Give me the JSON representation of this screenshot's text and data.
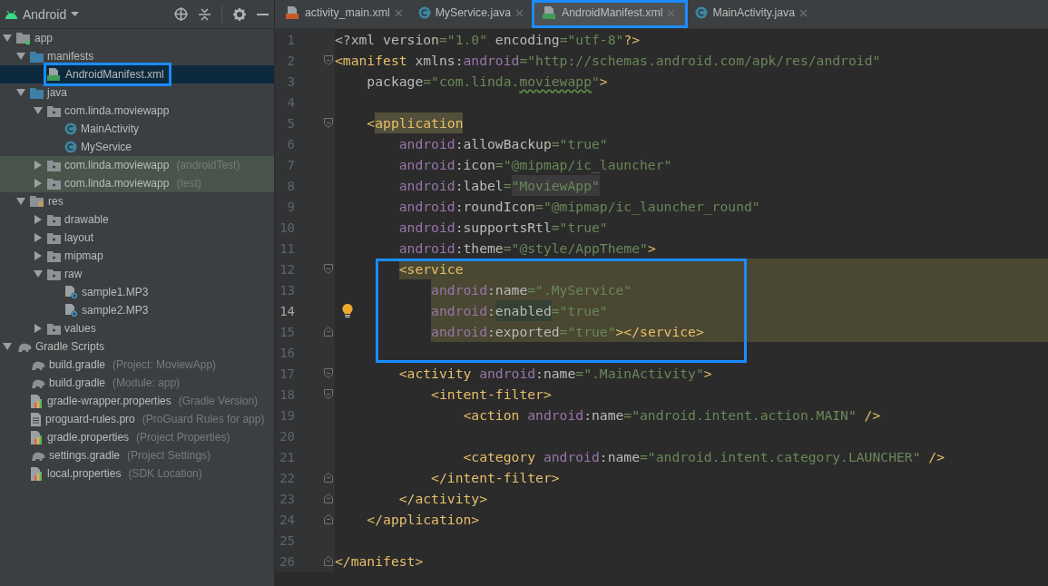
{
  "project_panel": {
    "view_title": "Android",
    "tree": [
      {
        "label": "app",
        "kind": "module",
        "expanded": true,
        "selected": false,
        "children": [
          {
            "label": "manifests",
            "kind": "folder",
            "expanded": true,
            "selected": false,
            "children": [
              {
                "label": "AndroidManifest.xml",
                "kind": "manifest",
                "selected": true,
                "annotated": true
              }
            ]
          },
          {
            "label": "java",
            "kind": "folder",
            "expanded": true,
            "selected": false,
            "children": [
              {
                "label": "com.linda.moviewapp",
                "kind": "package",
                "expanded": true,
                "selected": false,
                "children": [
                  {
                    "label": "MainActivity",
                    "kind": "class",
                    "selected": false
                  },
                  {
                    "label": "MyService",
                    "kind": "class",
                    "selected": false
                  }
                ]
              },
              {
                "label": "com.linda.moviewapp",
                "hint": "(androidTest)",
                "kind": "package",
                "expanded": false,
                "selected": false,
                "tinted": true
              },
              {
                "label": "com.linda.moviewapp",
                "hint": "(test)",
                "kind": "package",
                "expanded": false,
                "selected": false,
                "tinted": true
              }
            ]
          },
          {
            "label": "res",
            "kind": "res-folder",
            "expanded": true,
            "selected": false,
            "children": [
              {
                "label": "drawable",
                "kind": "package",
                "expanded": false,
                "selected": false
              },
              {
                "label": "layout",
                "kind": "package",
                "expanded": false,
                "selected": false
              },
              {
                "label": "mipmap",
                "kind": "package",
                "expanded": false,
                "selected": false
              },
              {
                "label": "raw",
                "kind": "package",
                "expanded": true,
                "selected": false,
                "children": [
                  {
                    "label": "sample1.MP3",
                    "kind": "unknown",
                    "selected": false
                  },
                  {
                    "label": "sample2.MP3",
                    "kind": "unknown",
                    "selected": false
                  }
                ]
              },
              {
                "label": "values",
                "kind": "package",
                "expanded": false,
                "selected": false
              }
            ]
          }
        ]
      },
      {
        "label": "Gradle Scripts",
        "kind": "gradle",
        "expanded": true,
        "selected": false,
        "children": [
          {
            "label": "build.gradle",
            "hint": "(Project: MoviewApp)",
            "kind": "gradle",
            "selected": false
          },
          {
            "label": "build.gradle",
            "hint": "(Module: app)",
            "kind": "gradle",
            "selected": false
          },
          {
            "label": "gradle-wrapper.properties",
            "hint": "(Gradle Version)",
            "kind": "properties",
            "selected": false
          },
          {
            "label": "proguard-rules.pro",
            "hint": "(ProGuard Rules for app)",
            "kind": "text",
            "selected": false
          },
          {
            "label": "gradle.properties",
            "hint": "(Project Properties)",
            "kind": "properties",
            "selected": false
          },
          {
            "label": "settings.gradle",
            "hint": "(Project Settings)",
            "kind": "gradle",
            "selected": false
          },
          {
            "label": "local.properties",
            "hint": "(SDK Location)",
            "kind": "properties",
            "selected": false
          }
        ]
      }
    ]
  },
  "editor": {
    "tabs": [
      {
        "label": "activity_main.xml",
        "kind": "layout",
        "selected": false
      },
      {
        "label": "MyService.java",
        "kind": "class",
        "selected": false
      },
      {
        "label": "AndroidManifest.xml",
        "kind": "manifest",
        "selected": true,
        "annotated": true
      },
      {
        "label": "MainActivity.java",
        "kind": "class",
        "selected": false
      }
    ],
    "lines": [
      {
        "number": "1",
        "tokens": [
          {
            "kind": "plain",
            "t": "<?xml version"
          },
          {
            "kind": "val",
            "t": "=\"1.0\""
          },
          {
            "kind": "plain",
            "t": " encoding"
          },
          {
            "kind": "val",
            "t": "=\"utf-8\""
          },
          {
            "kind": "tag",
            "t": "?>"
          }
        ]
      },
      {
        "number": "2",
        "fold_start": true,
        "tokens": [
          {
            "kind": "tag",
            "t": "<manifest"
          },
          {
            "kind": "plain",
            "t": " xmlns:"
          },
          {
            "kind": "ns",
            "t": "android"
          },
          {
            "kind": "val",
            "t": "=\"http://schemas.android.com/apk/res/android\""
          }
        ]
      },
      {
        "number": "3",
        "tokens": [
          {
            "kind": "plain",
            "t": "    package"
          },
          {
            "kind": "val",
            "t": "=\"com.linda."
          },
          {
            "kind": "val",
            "t": "moviewapp",
            "typo": true
          },
          {
            "kind": "val",
            "t": "\""
          },
          {
            "kind": "tag",
            "t": ">"
          }
        ]
      },
      {
        "number": "4"
      },
      {
        "number": "5",
        "fold_start": true,
        "tokens": [
          {
            "kind": "tag",
            "t": "    <"
          },
          {
            "kind": "tag",
            "t": "application",
            "highlighted": true
          }
        ]
      },
      {
        "number": "6",
        "tokens": [
          {
            "kind": "ns",
            "t": "        android"
          },
          {
            "kind": "plain",
            "t": ":allowBackup"
          },
          {
            "kind": "val",
            "t": "=\"true\""
          }
        ]
      },
      {
        "number": "7",
        "tokens": [
          {
            "kind": "ns",
            "t": "        android"
          },
          {
            "kind": "plain",
            "t": ":icon"
          },
          {
            "kind": "val",
            "t": "=\"@mipmap/ic_launcher\""
          }
        ]
      },
      {
        "number": "8",
        "tokens": [
          {
            "kind": "ns",
            "t": "        android"
          },
          {
            "kind": "plain",
            "t": ":label"
          },
          {
            "kind": "val",
            "t": "="
          },
          {
            "kind": "val",
            "t": "\"MoviewApp\"",
            "highlighted": true
          }
        ]
      },
      {
        "number": "9",
        "tokens": [
          {
            "kind": "ns",
            "t": "        android"
          },
          {
            "kind": "plain",
            "t": ":roundIcon"
          },
          {
            "kind": "val",
            "t": "=\"@mipmap/ic_launcher_round\""
          }
        ]
      },
      {
        "number": "10",
        "tokens": [
          {
            "kind": "ns",
            "t": "        android"
          },
          {
            "kind": "plain",
            "t": ":supportsRtl"
          },
          {
            "kind": "val",
            "t": "=\"true\""
          }
        ]
      },
      {
        "number": "11",
        "tokens": [
          {
            "kind": "ns",
            "t": "        android"
          },
          {
            "kind": "plain",
            "t": ":theme"
          },
          {
            "kind": "val",
            "t": "=\"@style/AppTheme\""
          },
          {
            "kind": "tag",
            "t": ">"
          }
        ]
      },
      {
        "number": "12",
        "fold_start": true,
        "band": true,
        "boxed": true,
        "tokens": [
          {
            "kind": "tag",
            "t": "        <service"
          }
        ]
      },
      {
        "number": "13",
        "band": true,
        "boxed": true,
        "tokens": [
          {
            "kind": "ns",
            "t": "            android"
          },
          {
            "kind": "plain",
            "t": ":name"
          },
          {
            "kind": "val",
            "t": "=\".MyService\""
          }
        ]
      },
      {
        "number": "14",
        "band": true,
        "boxed": true,
        "current": true,
        "intention": true,
        "tokens": [
          {
            "kind": "ns",
            "t": "            android"
          },
          {
            "kind": "plain",
            "t": ":"
          },
          {
            "kind": "attr",
            "t": "enabled",
            "highlighted": true
          },
          {
            "kind": "val",
            "t": "=\"true\""
          }
        ]
      },
      {
        "number": "15",
        "fold_end": true,
        "band": true,
        "boxed": true,
        "tokens": [
          {
            "kind": "ns",
            "t": "            android"
          },
          {
            "kind": "plain",
            "t": ":exported"
          },
          {
            "kind": "val",
            "t": "=\"true\""
          },
          {
            "kind": "tag",
            "t": "></service>"
          }
        ]
      },
      {
        "number": "16",
        "boxed": true
      },
      {
        "number": "17",
        "fold_start": true,
        "tokens": [
          {
            "kind": "tag",
            "t": "        <activity "
          },
          {
            "kind": "ns",
            "t": "android"
          },
          {
            "kind": "plain",
            "t": ":name"
          },
          {
            "kind": "val",
            "t": "=\".MainActivity\""
          },
          {
            "kind": "tag",
            "t": ">"
          }
        ]
      },
      {
        "number": "18",
        "fold_start": true,
        "tokens": [
          {
            "kind": "tag",
            "t": "            <intent-filter>"
          }
        ]
      },
      {
        "number": "19",
        "tokens": [
          {
            "kind": "tag",
            "t": "                <action "
          },
          {
            "kind": "ns",
            "t": "android"
          },
          {
            "kind": "plain",
            "t": ":name"
          },
          {
            "kind": "val",
            "t": "=\"android.intent.action.MAIN\""
          },
          {
            "kind": "tag",
            "t": " />"
          }
        ]
      },
      {
        "number": "20"
      },
      {
        "number": "21",
        "tokens": [
          {
            "kind": "tag",
            "t": "                <category "
          },
          {
            "kind": "ns",
            "t": "android"
          },
          {
            "kind": "plain",
            "t": ":name"
          },
          {
            "kind": "val",
            "t": "=\"android.intent.category.LAUNCHER\""
          },
          {
            "kind": "tag",
            "t": " />"
          }
        ]
      },
      {
        "number": "22",
        "fold_end": true,
        "tokens": [
          {
            "kind": "tag",
            "t": "            </intent-filter>"
          }
        ]
      },
      {
        "number": "23",
        "fold_end": true,
        "tokens": [
          {
            "kind": "tag",
            "t": "        </activity>"
          }
        ]
      },
      {
        "number": "24",
        "fold_end": true,
        "tokens": [
          {
            "kind": "tag",
            "t": "    </application>"
          }
        ]
      },
      {
        "number": "25"
      },
      {
        "number": "26",
        "fold_end": true,
        "tokens": [
          {
            "kind": "tag",
            "t": "</manifest>"
          }
        ]
      }
    ]
  }
}
